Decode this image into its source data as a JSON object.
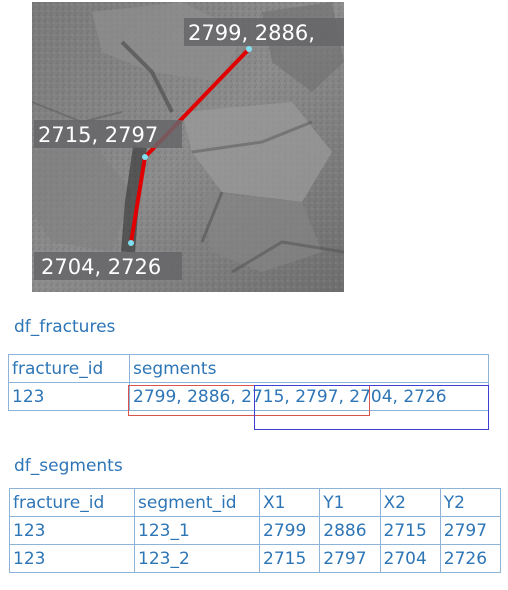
{
  "image_labels": {
    "p1": "2799, 2886,",
    "p2": "2715, 2797",
    "p3": "2704, 2726"
  },
  "colors": {
    "fracture_line": "#e00000",
    "node_point": "#7fe0f0",
    "label_bg": "#66666a",
    "table_text": "#2e75b6",
    "table_border": "#8db3d9",
    "highlight_red": "#d9534f",
    "highlight_blue": "#3f3fd4"
  },
  "df_fractures": {
    "title": "df_fractures",
    "headers": [
      "fracture_id",
      "segments"
    ],
    "rows": [
      [
        "123",
        "2799, 2886, 2715, 2797, 2704, 2726"
      ]
    ]
  },
  "df_segments": {
    "title": "df_segments",
    "headers": [
      "fracture_id",
      "segment_id",
      "X1",
      "Y1",
      "X2",
      "Y2"
    ],
    "rows": [
      [
        "123",
        "123_1",
        "2799",
        "2886",
        "2715",
        "2797"
      ],
      [
        "123",
        "123_2",
        "2715",
        "2797",
        "2704",
        "2726"
      ]
    ]
  }
}
